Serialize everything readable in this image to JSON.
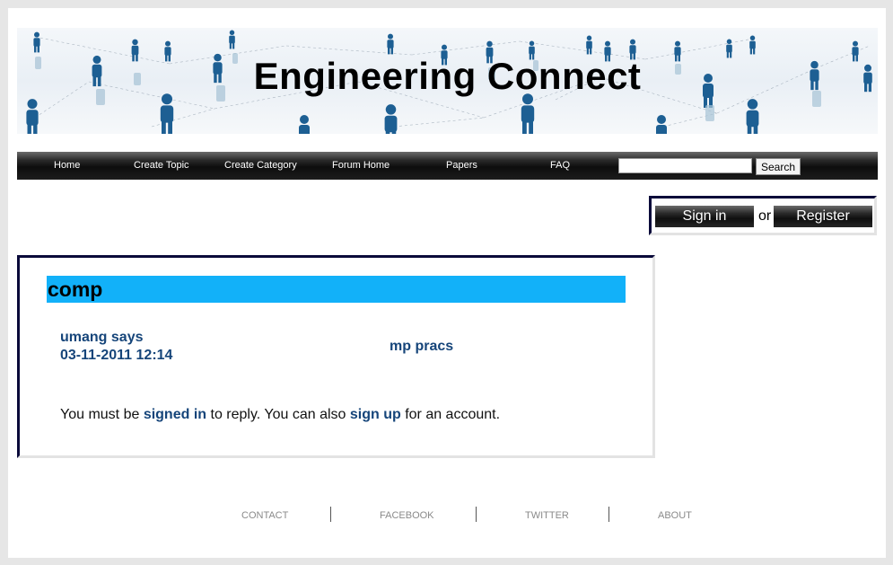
{
  "header": {
    "site_title": "Engineering Connect"
  },
  "nav": {
    "items": [
      {
        "label": "Home"
      },
      {
        "label": "Create Topic"
      },
      {
        "label": "Create Category"
      },
      {
        "label": "Forum Home"
      },
      {
        "label": "Papers"
      },
      {
        "label": "FAQ"
      }
    ],
    "search": {
      "value": "",
      "button_label": "Search"
    }
  },
  "auth": {
    "sign_in_label": "Sign in",
    "or_text": "or",
    "register_label": "Register"
  },
  "topic": {
    "category": "comp",
    "post": {
      "author_line": "umang says",
      "timestamp": "03-11-2011 12:14",
      "title": "mp pracs"
    },
    "reply_note": {
      "prefix": "You must be ",
      "signed_in_link": "signed in",
      "middle": " to reply. You can also ",
      "sign_up_link": "sign up",
      "suffix": " for an account."
    }
  },
  "footer": {
    "links": [
      {
        "label": "CONTACT"
      },
      {
        "label": "FACEBOOK"
      },
      {
        "label": "TWITTER"
      },
      {
        "label": "ABOUT"
      }
    ]
  },
  "colors": {
    "category_bar": "#12b1f9",
    "link_blue": "#16457a",
    "nav_bg": "#111111",
    "panel_border": "#0a0a3a"
  }
}
